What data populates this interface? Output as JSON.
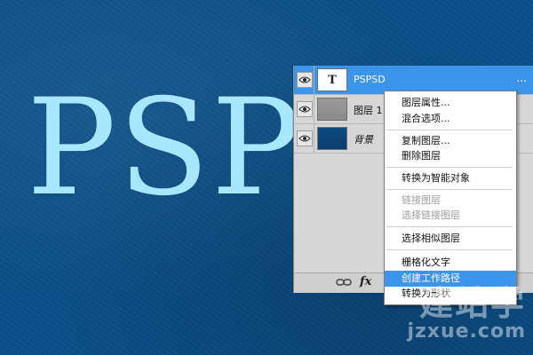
{
  "canvas": {
    "text": "PSP"
  },
  "layers": {
    "rows": [
      {
        "name": "PSPSD",
        "options": "...",
        "thumb": "T",
        "selected": true
      },
      {
        "name": "图层 1"
      },
      {
        "name": "背景"
      }
    ],
    "footer": {
      "fx_label": "fx"
    }
  },
  "context_menu": {
    "items": [
      {
        "label": "图层属性..."
      },
      {
        "label": "混合选项..."
      },
      {
        "label": "复制图层..."
      },
      {
        "label": "删除图层"
      },
      {
        "label": "转换为智能对象"
      },
      {
        "label": "链接图层",
        "disabled": true
      },
      {
        "label": "选择链接图层",
        "disabled": true
      },
      {
        "label": "选择相似图层"
      },
      {
        "label": "栅格化文字"
      },
      {
        "label": "创建工作路径",
        "highlighted": true
      },
      {
        "label": "转换为形状"
      }
    ]
  },
  "watermark": {
    "cn": "建站学",
    "url": "jzxue.com"
  },
  "colors": {
    "canvas_bg": "#0b4f88",
    "text_color": "#a9e6ff",
    "selection": "#3c95e9",
    "panel_bg": "#d6d6d6"
  }
}
